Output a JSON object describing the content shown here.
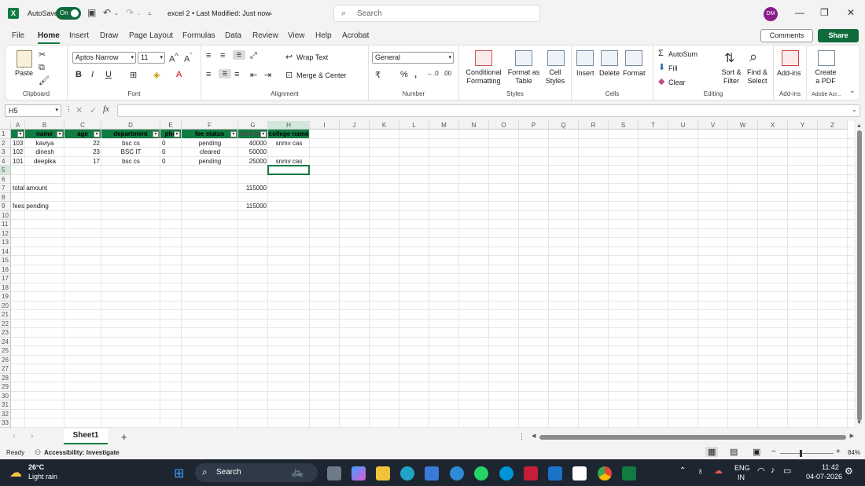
{
  "titlebar": {
    "autosave_label": "AutoSave",
    "autosave_state": "On",
    "doc_title": "excel 2 • Last Modified: Just now",
    "search_placeholder": "Search",
    "avatar_initials": "DM"
  },
  "tabs": [
    "File",
    "Home",
    "Insert",
    "Draw",
    "Page Layout",
    "Formulas",
    "Data",
    "Review",
    "View",
    "Help",
    "Acrobat"
  ],
  "active_tab": "Home",
  "actions": {
    "comments": "Comments",
    "share": "Share"
  },
  "ribbon": {
    "clipboard": {
      "paste": "Paste",
      "group": "Clipboard"
    },
    "font": {
      "family": "Aptos Narrow",
      "size": "11",
      "group": "Font"
    },
    "alignment": {
      "wrap": "Wrap Text",
      "merge": "Merge & Center",
      "group": "Alignment"
    },
    "number": {
      "format": "General",
      "group": "Number"
    },
    "styles": {
      "conditional": "Conditional",
      "conditional2": "Formatting",
      "format_as": "Format as",
      "format_as2": "Table",
      "cell_styles": "Cell",
      "cell_styles2": "Styles",
      "group": "Styles"
    },
    "cells": {
      "insert": "Insert",
      "delete": "Delete",
      "format": "Format",
      "group": "Cells"
    },
    "editing": {
      "autosum": "AutoSum",
      "fill": "Fill",
      "clear": "Clear",
      "sort": "Sort &",
      "sort2": "Filter",
      "find": "Find &",
      "find2": "Select",
      "group": "Editing"
    },
    "addins": {
      "label": "Add-ins",
      "group": "Add-ins"
    },
    "acrobat": {
      "label": "Create",
      "label2": "a PDF",
      "group": "Adobe Acr..."
    }
  },
  "formula_bar": {
    "name_box": "H5",
    "fx": "fx",
    "content": ""
  },
  "columns": [
    "A",
    "B",
    "C",
    "D",
    "E",
    "F",
    "G",
    "H",
    "I",
    "J",
    "K",
    "L",
    "M",
    "N",
    "O",
    "P",
    "Q",
    "R",
    "S",
    "T",
    "U",
    "V",
    "W",
    "X",
    "Y",
    "Z"
  ],
  "rows": [
    "1",
    "2",
    "3",
    "4",
    "5",
    "6",
    "7",
    "8",
    "9",
    "10",
    "11",
    "12",
    "13",
    "14",
    "15",
    "16",
    "17",
    "18",
    "19",
    "20",
    "21",
    "22",
    "23",
    "24",
    "25",
    "26",
    "27",
    "28",
    "29",
    "30",
    "31",
    "32",
    "33"
  ],
  "table": {
    "headers": {
      "B": "name",
      "C": "age",
      "D": "department",
      "E": "pho",
      "F": "fee status",
      "G": "total fe",
      "H": "college name"
    },
    "data": [
      {
        "A": "103",
        "B": "kaviya",
        "C": "22",
        "D": "bsc cs",
        "E": "0",
        "F": "pending",
        "G": "40000",
        "H": "snmv cas"
      },
      {
        "A": "102",
        "B": "dinesh",
        "C": "23",
        "D": "BSC IT",
        "E": "0",
        "F": "cleared",
        "G": "50000",
        "H": ""
      },
      {
        "A": "101",
        "B": "deepika",
        "C": "17",
        "D": "bsc cs",
        "E": "0",
        "F": "pending",
        "G": "25000",
        "H": "snmv cas"
      }
    ],
    "summary": [
      {
        "label": "total amount",
        "value": "115000"
      },
      {
        "label": "fees pending",
        "value": "115000"
      }
    ]
  },
  "sheet_tab": "Sheet1",
  "status": {
    "ready": "Ready",
    "accessibility": "Accessibility: Investigate",
    "zoom": "84%"
  },
  "taskbar": {
    "weather_temp": "26°C",
    "weather_desc": "Light rain",
    "search": "Search",
    "lang1": "ENG",
    "lang2": "IN",
    "time": "11:42",
    "date": "04-07-2026"
  },
  "colors": {
    "excel_green": "#107c41",
    "header_fill": "#107c41"
  }
}
